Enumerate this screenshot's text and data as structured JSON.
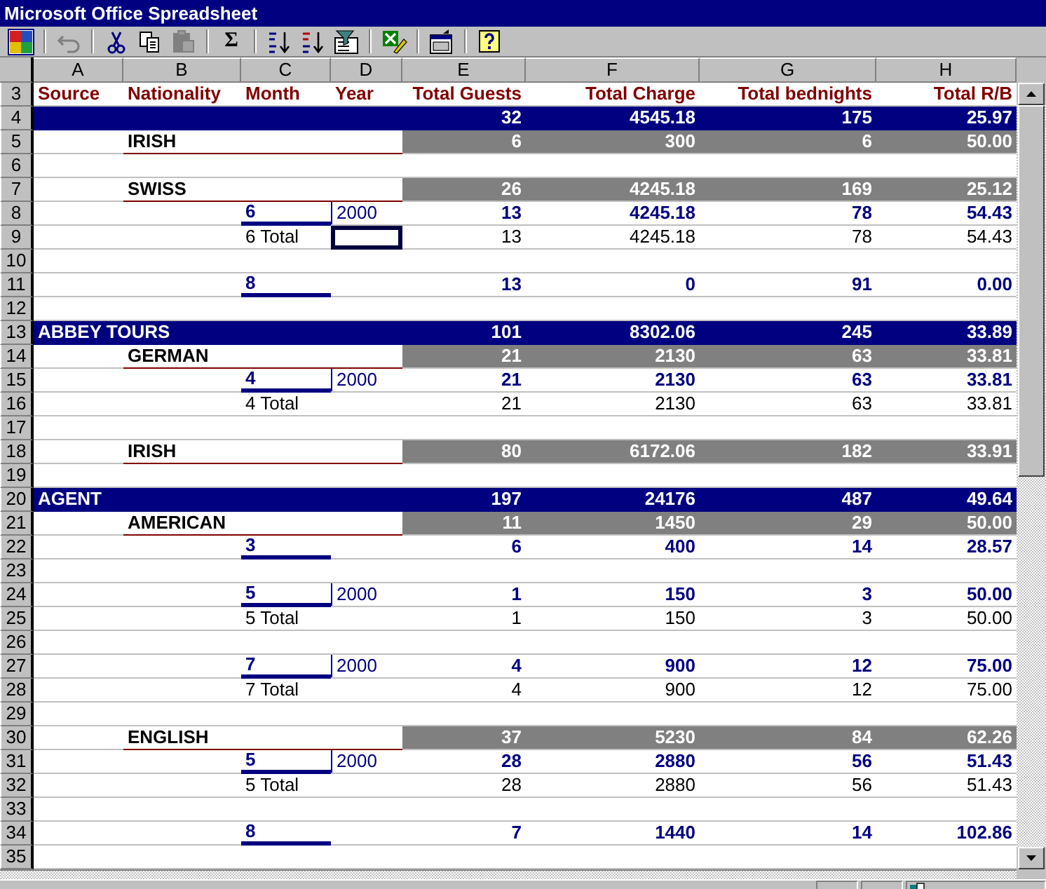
{
  "window": {
    "title": "Microsoft Office Spreadsheet"
  },
  "toolbar": [
    {
      "kind": "logo",
      "disabled": false
    },
    {
      "kind": "separator"
    },
    {
      "kind": "undo",
      "disabled": true
    },
    {
      "kind": "separator"
    },
    {
      "kind": "cut",
      "disabled": false
    },
    {
      "kind": "copy",
      "disabled": false
    },
    {
      "kind": "paste",
      "disabled": true
    },
    {
      "kind": "separator"
    },
    {
      "kind": "sum",
      "label": "Σ",
      "disabled": false
    },
    {
      "kind": "separator"
    },
    {
      "kind": "sort-ascending",
      "disabled": false
    },
    {
      "kind": "sort-descending",
      "disabled": false
    },
    {
      "kind": "filter",
      "disabled": false
    },
    {
      "kind": "separator"
    },
    {
      "kind": "export",
      "disabled": false
    },
    {
      "kind": "separator"
    },
    {
      "kind": "properties",
      "disabled": false
    },
    {
      "kind": "separator"
    },
    {
      "kind": "help",
      "disabled": false
    }
  ],
  "columns": [
    "A",
    "B",
    "C",
    "D",
    "E",
    "F",
    "G",
    "H"
  ],
  "rows": [
    {
      "number": "3",
      "kind": "header",
      "selected": false,
      "source": "Source",
      "nationality": "Nationality",
      "month": "Month",
      "year": "Year",
      "values": [
        "Total Guests",
        "Total Charge",
        "Total bednights",
        "Total R/B"
      ]
    },
    {
      "number": "4",
      "kind": "source",
      "selected": false,
      "values": [
        "32",
        "4545.18",
        "175",
        "25.97"
      ]
    },
    {
      "number": "5",
      "kind": "nationality",
      "selected": false,
      "nationality": "IRISH",
      "values": [
        "6",
        "300",
        "6",
        "50.00"
      ]
    },
    {
      "number": "6",
      "kind": "empty",
      "selected": false
    },
    {
      "number": "7",
      "kind": "nationality",
      "selected": false,
      "nationality": "SWISS",
      "values": [
        "26",
        "4245.18",
        "169",
        "25.12"
      ]
    },
    {
      "number": "8",
      "kind": "month",
      "selected": false,
      "month": "6",
      "year": "2000",
      "values": [
        "13",
        "4245.18",
        "78",
        "54.43"
      ]
    },
    {
      "number": "9",
      "kind": "total",
      "selected": true,
      "month": "6 Total",
      "values": [
        "13",
        "4245.18",
        "78",
        "54.43"
      ]
    },
    {
      "number": "10",
      "kind": "empty",
      "selected": false
    },
    {
      "number": "11",
      "kind": "month",
      "selected": false,
      "month": "8",
      "values": [
        "13",
        "0",
        "91",
        "0.00"
      ]
    },
    {
      "number": "12",
      "kind": "empty",
      "selected": false
    },
    {
      "number": "13",
      "kind": "source",
      "selected": false,
      "source": "ABBEY TOURS",
      "values": [
        "101",
        "8302.06",
        "245",
        "33.89"
      ]
    },
    {
      "number": "14",
      "kind": "nationality",
      "selected": false,
      "nationality": "GERMAN",
      "values": [
        "21",
        "2130",
        "63",
        "33.81"
      ]
    },
    {
      "number": "15",
      "kind": "month",
      "selected": false,
      "month": "4",
      "year": "2000",
      "values": [
        "21",
        "2130",
        "63",
        "33.81"
      ]
    },
    {
      "number": "16",
      "kind": "total",
      "selected": false,
      "month": "4 Total",
      "values": [
        "21",
        "2130",
        "63",
        "33.81"
      ]
    },
    {
      "number": "17",
      "kind": "empty",
      "selected": false
    },
    {
      "number": "18",
      "kind": "nationality",
      "selected": false,
      "nationality": "IRISH",
      "values": [
        "80",
        "6172.06",
        "182",
        "33.91"
      ]
    },
    {
      "number": "19",
      "kind": "empty",
      "selected": false
    },
    {
      "number": "20",
      "kind": "source",
      "selected": false,
      "source": "AGENT",
      "values": [
        "197",
        "24176",
        "487",
        "49.64"
      ]
    },
    {
      "number": "21",
      "kind": "nationality",
      "selected": false,
      "nationality": "AMERICAN",
      "values": [
        "11",
        "1450",
        "29",
        "50.00"
      ]
    },
    {
      "number": "22",
      "kind": "month",
      "selected": false,
      "month": "3",
      "values": [
        "6",
        "400",
        "14",
        "28.57"
      ]
    },
    {
      "number": "23",
      "kind": "empty",
      "selected": false
    },
    {
      "number": "24",
      "kind": "month",
      "selected": false,
      "month": "5",
      "year": "2000",
      "values": [
        "1",
        "150",
        "3",
        "50.00"
      ]
    },
    {
      "number": "25",
      "kind": "total",
      "selected": false,
      "month": "5 Total",
      "values": [
        "1",
        "150",
        "3",
        "50.00"
      ]
    },
    {
      "number": "26",
      "kind": "empty",
      "selected": false
    },
    {
      "number": "27",
      "kind": "month",
      "selected": false,
      "month": "7",
      "year": "2000",
      "values": [
        "4",
        "900",
        "12",
        "75.00"
      ]
    },
    {
      "number": "28",
      "kind": "total",
      "selected": false,
      "month": "7 Total",
      "values": [
        "4",
        "900",
        "12",
        "75.00"
      ]
    },
    {
      "number": "29",
      "kind": "empty",
      "selected": false
    },
    {
      "number": "30",
      "kind": "nationality",
      "selected": false,
      "nationality": "ENGLISH",
      "values": [
        "37",
        "5230",
        "84",
        "62.26"
      ]
    },
    {
      "number": "31",
      "kind": "month",
      "selected": false,
      "month": "5",
      "year": "2000",
      "values": [
        "28",
        "2880",
        "56",
        "51.43"
      ]
    },
    {
      "number": "32",
      "kind": "total",
      "selected": false,
      "month": "5 Total",
      "values": [
        "28",
        "2880",
        "56",
        "51.43"
      ]
    },
    {
      "number": "33",
      "kind": "empty",
      "selected": false
    },
    {
      "number": "34",
      "kind": "month",
      "selected": false,
      "month": "8",
      "values": [
        "7",
        "1440",
        "14",
        "102.86"
      ]
    },
    {
      "number": "35",
      "kind": "empty",
      "selected": false
    }
  ]
}
